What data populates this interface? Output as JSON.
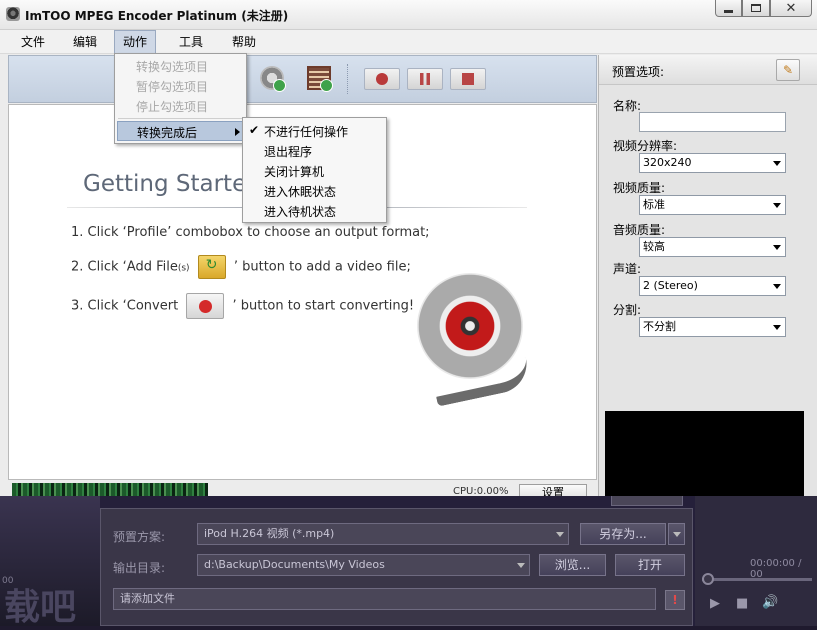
{
  "window": {
    "title": "ImTOO MPEG Encoder Platinum (未注册)"
  },
  "menubar": {
    "items": [
      "文件",
      "编辑",
      "动作",
      "工具",
      "帮助"
    ]
  },
  "action_menu": {
    "items": [
      "转换勾选项目",
      "暂停勾选项目",
      "停止勾选项目"
    ],
    "submenu_label": "转换完成后"
  },
  "after_convert_submenu": {
    "checked_index": 0,
    "items": [
      "不进行任何操作",
      "退出程序",
      "关闭计算机",
      "进入休眠状态",
      "进入待机状态"
    ]
  },
  "main": {
    "getting_started": "Getting Started",
    "step1": "1. Click ‘Profile’ combobox to choose an output format;",
    "step2_a": "2. Click ‘Add File",
    "step2_s": "(s)",
    "step2_b": "’ button to add a video file;",
    "step3_a": "3. Click ‘Convert",
    "step3_b": "’ button to start converting!"
  },
  "profile_panel": {
    "title": "预置选项:",
    "name_label": "名称:",
    "name_value": "",
    "resolution_label": "视频分辨率:",
    "resolution_value": "320x240",
    "video_quality_label": "视频质量:",
    "video_quality_value": "标准",
    "audio_quality_label": "音频质量:",
    "audio_quality_value": "较高",
    "channel_label": "声道:",
    "channel_value": "2 (Stereo)",
    "split_label": "分割:",
    "split_value": "不分割"
  },
  "status": {
    "cpu": "CPU:0.00%",
    "settings_button": "设置"
  },
  "background_window": {
    "preset_label": "预置方案:",
    "preset_value": "iPod H.264 视频 (*.mp4)",
    "save_as_button": "另存为...",
    "output_label": "输出目录:",
    "output_value": "d:\\Backup\\Documents\\My Videos",
    "browse_button": "浏览...",
    "open_button": "打开",
    "add_file_hint": "请添加文件",
    "time_right": "00:00:00 / 00",
    "time_left": "00",
    "watermark": "载吧"
  }
}
